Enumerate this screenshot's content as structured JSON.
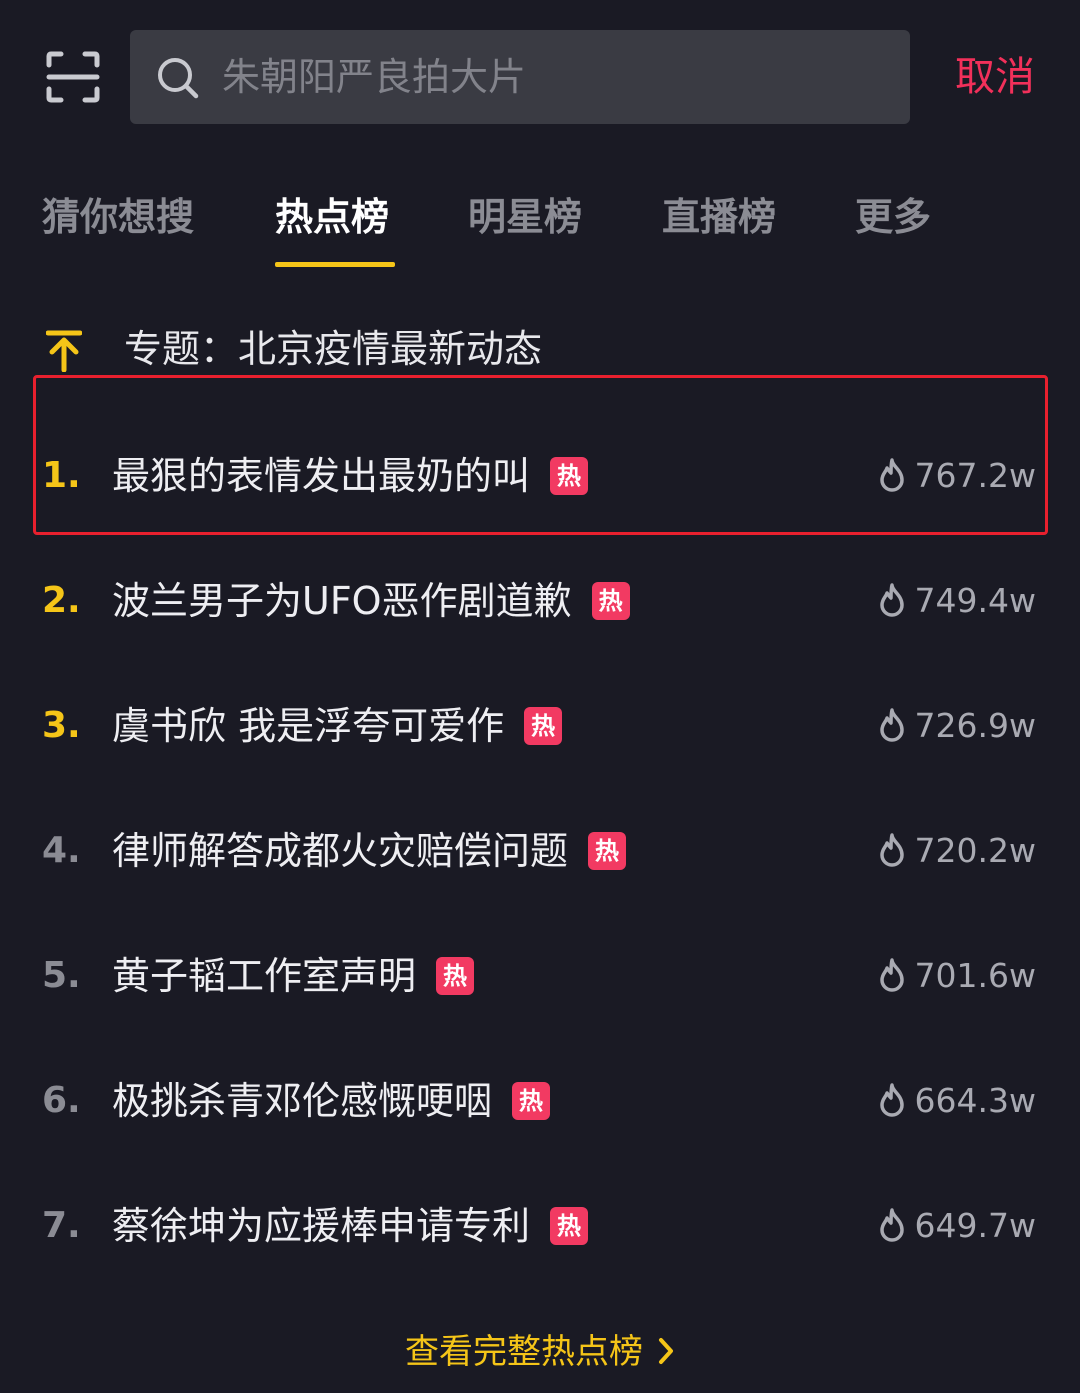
{
  "header": {
    "scan_icon": "scan-icon",
    "search_placeholder": "朱朝阳严良拍大片",
    "cancel_label": "取消"
  },
  "tabs": [
    {
      "label": "猜你想搜",
      "active": false
    },
    {
      "label": "热点榜",
      "active": true
    },
    {
      "label": "明星榜",
      "active": false
    },
    {
      "label": "直播榜",
      "active": false
    },
    {
      "label": "更多",
      "active": false
    }
  ],
  "pinned": {
    "icon": "pin-top-icon",
    "text": "专题：北京疫情最新动态"
  },
  "list": [
    {
      "rank": "1.",
      "title": "最狠的表情发出最奶的叫",
      "badge": "热",
      "heat": "767.2w"
    },
    {
      "rank": "2.",
      "title": "波兰男子为UFO恶作剧道歉",
      "badge": "热",
      "heat": "749.4w"
    },
    {
      "rank": "3.",
      "title": "虞书欣 我是浮夸可爱作",
      "badge": "热",
      "heat": "726.9w"
    },
    {
      "rank": "4.",
      "title": "律师解答成都火灾赔偿问题",
      "badge": "热",
      "heat": "720.2w"
    },
    {
      "rank": "5.",
      "title": "黄子韬工作室声明",
      "badge": "热",
      "heat": "701.6w"
    },
    {
      "rank": "6.",
      "title": "极挑杀青邓伦感慨哽咽",
      "badge": "热",
      "heat": "664.3w"
    },
    {
      "rank": "7.",
      "title": "蔡徐坤为应援棒申请专利",
      "badge": "热",
      "heat": "649.7w"
    }
  ],
  "footer": {
    "view_all_label": "查看完整热点榜"
  },
  "colors": {
    "background": "#1a1a24",
    "accent_yellow": "#f5c518",
    "cancel_red": "#f2305a",
    "hot_badge": "#f23a62",
    "highlight_border": "#e8202e"
  }
}
